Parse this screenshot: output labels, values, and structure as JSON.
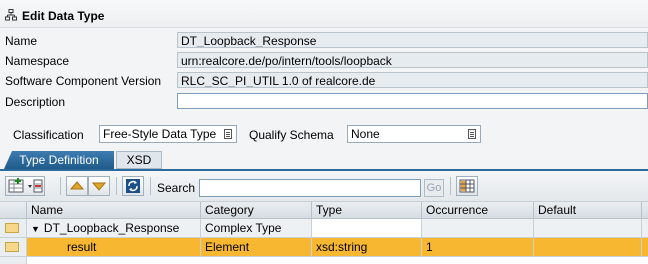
{
  "title": "Edit Data Type",
  "colors": {
    "tab_active": "#2b6a9a",
    "row_highlight": "#f8b731",
    "field_readonly": "#e6ebf0"
  },
  "form": {
    "name_label": "Name",
    "name_value": "DT_Loopback_Response",
    "namespace_label": "Namespace",
    "namespace_value": "urn:realcore.de/po/intern/tools/loopback",
    "scv_label": "Software Component Version",
    "scv_value": "RLC_SC_PI_UTIL 1.0 of realcore.de",
    "description_label": "Description",
    "description_value": "",
    "classification_label": "Classification",
    "classification_value": "Free-Style Data Type",
    "qualify_label": "Qualify Schema",
    "qualify_value": "None"
  },
  "tabs": [
    {
      "label": "Type Definition",
      "active": true
    },
    {
      "label": "XSD",
      "active": false
    }
  ],
  "toolbar": {
    "search_label": "Search",
    "search_value": "",
    "go_label": "Go",
    "icons": [
      "insert-row-icon",
      "delete-row-icon",
      "move-up-icon",
      "move-down-icon",
      "refresh-icon",
      "column-settings-icon"
    ]
  },
  "table": {
    "columns": [
      "Name",
      "Category",
      "Type",
      "Occurrence",
      "Default"
    ],
    "rows": [
      {
        "name": "DT_Loopback_Response",
        "category": "Complex Type",
        "type": "",
        "occurrence": "",
        "default": "",
        "expanded": true
      },
      {
        "name": "result",
        "category": "Element",
        "type": "xsd:string",
        "occurrence": "1",
        "default": "",
        "highlighted": true
      }
    ]
  }
}
